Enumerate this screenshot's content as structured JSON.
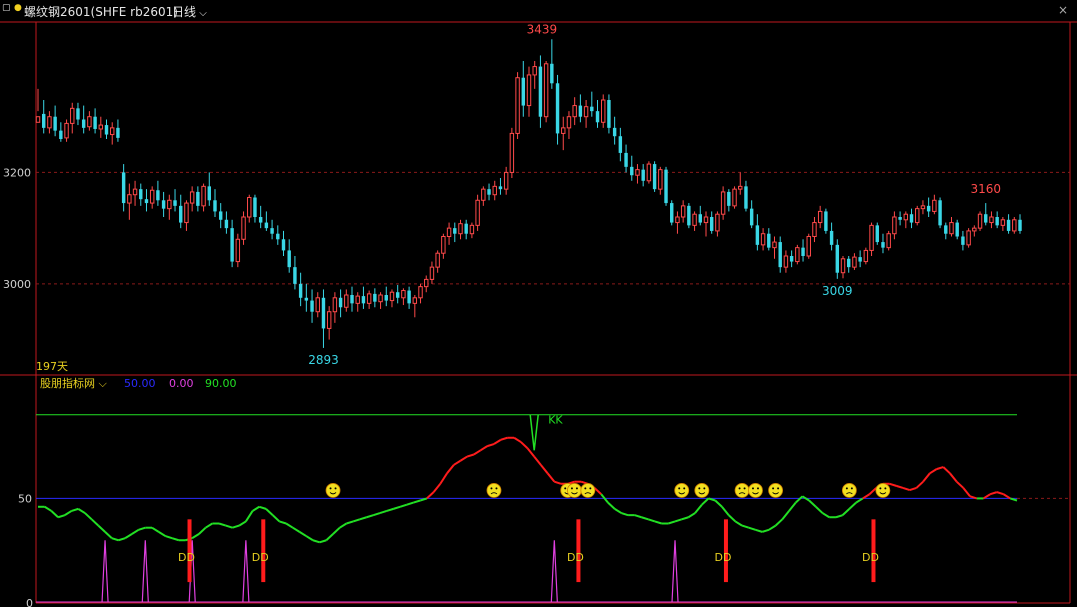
{
  "toolbar": {
    "symbol": "螺纹钢2601(SHFE rb2601)",
    "period": "日线"
  },
  "colors": {
    "up": "#ff4a4a",
    "down": "#3ad7e6",
    "axis": "#c0191e",
    "grid": "#8a1a1a",
    "green_line": "#22e024",
    "red_line": "#ff1c1c",
    "magenta": "#e040e0",
    "blue_line": "#2a2aff"
  },
  "main_panel": {
    "y_ticks": [
      3200,
      3000
    ],
    "labels": {
      "max": "3439",
      "min": "2893",
      "local_high": "3160",
      "local_low": "3009"
    },
    "days_label": "197天"
  },
  "indicator_panel": {
    "name": "股朋指标网",
    "legend_values": [
      "50.00",
      "0.00",
      "90.00"
    ],
    "y_ticks": [
      "50",
      "0"
    ],
    "signal_kk": "KK",
    "signal_dd": "DD"
  },
  "chart_data": [
    {
      "type": "candlestick",
      "title": "螺纹钢2601(SHFE rb2601)",
      "x": "day index 0-196",
      "ylim": [
        2840,
        3470
      ],
      "grid": "dashed at 3200, 3000",
      "candles": [
        [
          3290,
          3350,
          3310,
          3300
        ],
        [
          3305,
          3330,
          3270,
          3280
        ],
        [
          3280,
          3310,
          3270,
          3300
        ],
        [
          3300,
          3320,
          3265,
          3275
        ],
        [
          3275,
          3290,
          3255,
          3260
        ],
        [
          3262,
          3295,
          3255,
          3288
        ],
        [
          3288,
          3325,
          3270,
          3315
        ],
        [
          3315,
          3325,
          3285,
          3295
        ],
        [
          3295,
          3320,
          3270,
          3280
        ],
        [
          3282,
          3310,
          3275,
          3300
        ],
        [
          3300,
          3315,
          3270,
          3278
        ],
        [
          3278,
          3300,
          3262,
          3285
        ],
        [
          3285,
          3295,
          3260,
          3268
        ],
        [
          3268,
          3290,
          3250,
          3280
        ],
        [
          3280,
          3295,
          3255,
          3262
        ],
        [
          3200,
          3215,
          3130,
          3145
        ],
        [
          3145,
          3180,
          3115,
          3160
        ],
        [
          3160,
          3185,
          3140,
          3170
        ],
        [
          3170,
          3180,
          3140,
          3152
        ],
        [
          3152,
          3170,
          3130,
          3145
        ],
        [
          3145,
          3175,
          3135,
          3168
        ],
        [
          3168,
          3185,
          3140,
          3150
        ],
        [
          3150,
          3165,
          3120,
          3135
        ],
        [
          3135,
          3160,
          3115,
          3150
        ],
        [
          3150,
          3170,
          3130,
          3140
        ],
        [
          3140,
          3160,
          3100,
          3110
        ],
        [
          3110,
          3150,
          3095,
          3145
        ],
        [
          3145,
          3175,
          3130,
          3165
        ],
        [
          3165,
          3175,
          3130,
          3140
        ],
        [
          3140,
          3180,
          3130,
          3175
        ],
        [
          3175,
          3200,
          3140,
          3150
        ],
        [
          3150,
          3170,
          3120,
          3130
        ],
        [
          3130,
          3145,
          3100,
          3115
        ],
        [
          3115,
          3130,
          3090,
          3100
        ],
        [
          3100,
          3115,
          3030,
          3040
        ],
        [
          3040,
          3090,
          3030,
          3080
        ],
        [
          3080,
          3130,
          3070,
          3120
        ],
        [
          3120,
          3160,
          3110,
          3155
        ],
        [
          3155,
          3160,
          3110,
          3120
        ],
        [
          3120,
          3140,
          3100,
          3110
        ],
        [
          3110,
          3130,
          3095,
          3100
        ],
        [
          3100,
          3115,
          3080,
          3090
        ],
        [
          3090,
          3105,
          3070,
          3080
        ],
        [
          3080,
          3095,
          3050,
          3060
        ],
        [
          3060,
          3080,
          3020,
          3030
        ],
        [
          3030,
          3050,
          2990,
          3000
        ],
        [
          3000,
          3020,
          2960,
          2975
        ],
        [
          2975,
          3000,
          2950,
          2970
        ],
        [
          2970,
          2990,
          2930,
          2950
        ],
        [
          2950,
          2985,
          2940,
          2975
        ],
        [
          2975,
          2990,
          2885,
          2920
        ],
        [
          2920,
          2960,
          2900,
          2950
        ],
        [
          2950,
          2985,
          2930,
          2975
        ],
        [
          2975,
          2990,
          2940,
          2958
        ],
        [
          2958,
          2990,
          2950,
          2980
        ],
        [
          2980,
          2995,
          2950,
          2965
        ],
        [
          2965,
          2985,
          2950,
          2978
        ],
        [
          2978,
          2995,
          2955,
          2965
        ],
        [
          2965,
          2988,
          2955,
          2982
        ],
        [
          2982,
          2992,
          2958,
          2968
        ],
        [
          2968,
          2985,
          2955,
          2980
        ],
        [
          2980,
          2995,
          2960,
          2970
        ],
        [
          2970,
          2990,
          2958,
          2985
        ],
        [
          2985,
          2998,
          2965,
          2975
        ],
        [
          2975,
          2992,
          2962,
          2988
        ],
        [
          2988,
          2995,
          2955,
          2965
        ],
        [
          2965,
          2980,
          2940,
          2975
        ],
        [
          2975,
          3000,
          2965,
          2995
        ],
        [
          2995,
          3015,
          2985,
          3008
        ],
        [
          3008,
          3040,
          3000,
          3030
        ],
        [
          3030,
          3060,
          3020,
          3055
        ],
        [
          3055,
          3090,
          3045,
          3085
        ],
        [
          3085,
          3110,
          3070,
          3100
        ],
        [
          3100,
          3110,
          3075,
          3090
        ],
        [
          3090,
          3115,
          3080,
          3108
        ],
        [
          3108,
          3115,
          3080,
          3090
        ],
        [
          3090,
          3110,
          3082,
          3105
        ],
        [
          3105,
          3160,
          3095,
          3150
        ],
        [
          3150,
          3175,
          3140,
          3170
        ],
        [
          3170,
          3180,
          3150,
          3160
        ],
        [
          3160,
          3185,
          3150,
          3175
        ],
        [
          3175,
          3190,
          3160,
          3170
        ],
        [
          3170,
          3210,
          3160,
          3200
        ],
        [
          3200,
          3280,
          3190,
          3270
        ],
        [
          3270,
          3380,
          3260,
          3370
        ],
        [
          3370,
          3400,
          3300,
          3320
        ],
        [
          3320,
          3390,
          3300,
          3375
        ],
        [
          3375,
          3400,
          3350,
          3390
        ],
        [
          3390,
          3410,
          3280,
          3300
        ],
        [
          3300,
          3400,
          3290,
          3395
        ],
        [
          3395,
          3439,
          3350,
          3360
        ],
        [
          3360,
          3375,
          3250,
          3270
        ],
        [
          3270,
          3300,
          3240,
          3280
        ],
        [
          3280,
          3310,
          3260,
          3300
        ],
        [
          3300,
          3335,
          3285,
          3320
        ],
        [
          3320,
          3340,
          3290,
          3300
        ],
        [
          3300,
          3330,
          3280,
          3318
        ],
        [
          3318,
          3345,
          3300,
          3310
        ],
        [
          3310,
          3330,
          3280,
          3290
        ],
        [
          3290,
          3340,
          3280,
          3330
        ],
        [
          3330,
          3340,
          3270,
          3280
        ],
        [
          3280,
          3300,
          3250,
          3265
        ],
        [
          3265,
          3280,
          3220,
          3235
        ],
        [
          3235,
          3250,
          3200,
          3210
        ],
        [
          3210,
          3230,
          3185,
          3195
        ],
        [
          3195,
          3215,
          3180,
          3205
        ],
        [
          3205,
          3215,
          3175,
          3185
        ],
        [
          3185,
          3220,
          3180,
          3215
        ],
        [
          3215,
          3220,
          3165,
          3170
        ],
        [
          3170,
          3210,
          3160,
          3205
        ],
        [
          3205,
          3210,
          3140,
          3145
        ],
        [
          3145,
          3150,
          3105,
          3110
        ],
        [
          3110,
          3130,
          3090,
          3120
        ],
        [
          3120,
          3150,
          3110,
          3140
        ],
        [
          3140,
          3145,
          3100,
          3105
        ],
        [
          3105,
          3130,
          3095,
          3125
        ],
        [
          3125,
          3140,
          3105,
          3110
        ],
        [
          3110,
          3130,
          3085,
          3120
        ],
        [
          3120,
          3130,
          3090,
          3095
        ],
        [
          3095,
          3130,
          3085,
          3125
        ],
        [
          3125,
          3175,
          3115,
          3165
        ],
        [
          3165,
          3170,
          3130,
          3140
        ],
        [
          3140,
          3175,
          3135,
          3170
        ],
        [
          3170,
          3200,
          3160,
          3175
        ],
        [
          3175,
          3185,
          3130,
          3135
        ],
        [
          3135,
          3150,
          3100,
          3105
        ],
        [
          3105,
          3125,
          3060,
          3070
        ],
        [
          3070,
          3100,
          3060,
          3090
        ],
        [
          3090,
          3100,
          3060,
          3065
        ],
        [
          3065,
          3085,
          3045,
          3075
        ],
        [
          3075,
          3085,
          3020,
          3030
        ],
        [
          3030,
          3060,
          3020,
          3050
        ],
        [
          3050,
          3060,
          3030,
          3040
        ],
        [
          3040,
          3070,
          3035,
          3065
        ],
        [
          3065,
          3080,
          3040,
          3050
        ],
        [
          3050,
          3090,
          3045,
          3085
        ],
        [
          3085,
          3120,
          3075,
          3110
        ],
        [
          3110,
          3140,
          3100,
          3130
        ],
        [
          3130,
          3135,
          3090,
          3095
        ],
        [
          3095,
          3110,
          3060,
          3070
        ],
        [
          3070,
          3080,
          3009,
          3020
        ],
        [
          3020,
          3050,
          3010,
          3045
        ],
        [
          3045,
          3050,
          3020,
          3030
        ],
        [
          3030,
          3055,
          3025,
          3048
        ],
        [
          3048,
          3060,
          3030,
          3040
        ],
        [
          3040,
          3065,
          3035,
          3060
        ],
        [
          3060,
          3110,
          3050,
          3105
        ],
        [
          3105,
          3110,
          3070,
          3075
        ],
        [
          3075,
          3090,
          3055,
          3065
        ],
        [
          3065,
          3095,
          3060,
          3090
        ],
        [
          3090,
          3130,
          3080,
          3120
        ],
        [
          3120,
          3130,
          3105,
          3115
        ],
        [
          3115,
          3130,
          3100,
          3125
        ],
        [
          3125,
          3135,
          3100,
          3110
        ],
        [
          3110,
          3140,
          3105,
          3135
        ],
        [
          3135,
          3150,
          3125,
          3140
        ],
        [
          3140,
          3155,
          3120,
          3130
        ],
        [
          3130,
          3160,
          3125,
          3150
        ],
        [
          3150,
          3155,
          3100,
          3105
        ],
        [
          3105,
          3110,
          3080,
          3090
        ],
        [
          3090,
          3120,
          3085,
          3110
        ],
        [
          3110,
          3115,
          3080,
          3085
        ],
        [
          3085,
          3095,
          3060,
          3070
        ],
        [
          3070,
          3100,
          3065,
          3095
        ],
        [
          3095,
          3105,
          3085,
          3100
        ],
        [
          3100,
          3130,
          3095,
          3125
        ],
        [
          3125,
          3145,
          3105,
          3110
        ],
        [
          3110,
          3130,
          3100,
          3120
        ],
        [
          3120,
          3130,
          3100,
          3105
        ],
        [
          3105,
          3120,
          3095,
          3115
        ],
        [
          3115,
          3125,
          3090,
          3095
        ],
        [
          3095,
          3120,
          3090,
          3115
        ],
        [
          3115,
          3125,
          3090,
          3095
        ]
      ]
    },
    {
      "type": "line",
      "title": "股朋指标网",
      "ylim": [
        0,
        100
      ],
      "reference_lines": [
        50,
        90
      ],
      "main_line": [
        46,
        46,
        44,
        41,
        42,
        44,
        45,
        43,
        40,
        37,
        34,
        31,
        30,
        31,
        33,
        35,
        36,
        36,
        34,
        32,
        31,
        30,
        30,
        31,
        33,
        36,
        38,
        38,
        37,
        36,
        37,
        39,
        44,
        46,
        45,
        42,
        39,
        38,
        36,
        34,
        32,
        30,
        29,
        30,
        33,
        36,
        38,
        39,
        40,
        41,
        42,
        43,
        44,
        45,
        46,
        47,
        48,
        49,
        50,
        53,
        57,
        62,
        66,
        68,
        70,
        71,
        73,
        75,
        76,
        78,
        79,
        79,
        77,
        74,
        70,
        66,
        62,
        58,
        57,
        57,
        58,
        58,
        57,
        55,
        52,
        48,
        45,
        43,
        42,
        42,
        41,
        40,
        39,
        38,
        38,
        39,
        40,
        41,
        43,
        47,
        50,
        49,
        46,
        42,
        39,
        37,
        36,
        35,
        34,
        35,
        37,
        40,
        44,
        48,
        51,
        49,
        46,
        43,
        41,
        41,
        42,
        45,
        48,
        50,
        52,
        55,
        57,
        57,
        56,
        55,
        54,
        55,
        58,
        62,
        64,
        65,
        62,
        58,
        55,
        51,
        50,
        50,
        52,
        53,
        52,
        50,
        49
      ],
      "signals": {
        "KK_at": [
          74
        ],
        "DD_at": [
          22,
          33,
          80,
          102,
          124
        ],
        "magenta_spikes_at": [
          10,
          16,
          23,
          31,
          77,
          95
        ],
        "faces_at": [
          44,
          68,
          79,
          80,
          82,
          96,
          99,
          105,
          107,
          110,
          121,
          126
        ]
      }
    }
  ]
}
